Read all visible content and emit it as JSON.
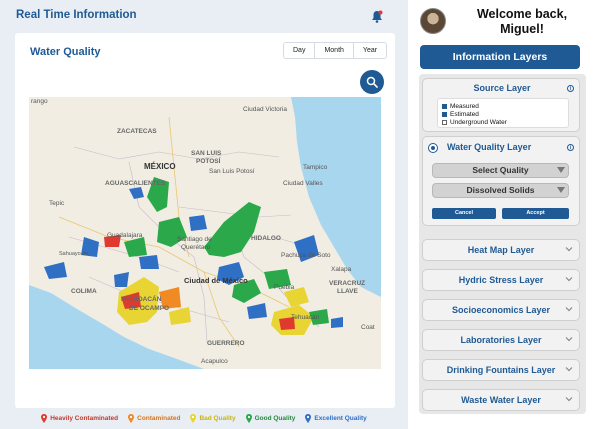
{
  "header": {
    "title": "Real Time Information"
  },
  "card": {
    "title": "Water Quality",
    "ranges": [
      "Day",
      "Month",
      "Year"
    ]
  },
  "map": {
    "labels": [
      "rango",
      "Ciudad Victoria",
      "ZACATECAS",
      "MÉXICO",
      "SAN LUIS",
      "POTOSÍ",
      "San Luis Potosí",
      "Tampico",
      "AGUASCALIENTES",
      "Ciudad Valles",
      "Tepic",
      "Guadalajara",
      "Santiago de",
      "Querétaro",
      "HIDALGO",
      "Pachuca de Soto",
      "Xalapa",
      "Sahuayo de",
      "Ciudad de México",
      "VERACRUZ",
      "LLAVE",
      "COLIMA",
      "MICHOACÁN",
      "DE OCAMPO",
      "Puebla",
      "Tehuacán",
      "Coat",
      "GUERRERO",
      "Acapulco"
    ]
  },
  "legend": [
    {
      "label": "Heavily Contaminated",
      "color": "#e03a2f"
    },
    {
      "label": "Contaminated",
      "color": "#f08a24"
    },
    {
      "label": "Bad Quality",
      "color": "#e8d534"
    },
    {
      "label": "Good Quality",
      "color": "#2aa84a"
    },
    {
      "label": "Excellent Quality",
      "color": "#2f6fc4"
    }
  ],
  "user": {
    "welcome_line1": "Welcome back,",
    "welcome_line2": "Miguel!"
  },
  "panel": {
    "title": "Information Layers",
    "source_layer": {
      "title": "Source Layer",
      "options": [
        {
          "label": "Measured",
          "checked": true
        },
        {
          "label": "Estimated",
          "checked": true
        },
        {
          "label": "Underground Water",
          "checked": false
        }
      ]
    },
    "water_quality_layer": {
      "title": "Water Quality Layer",
      "select_quality": "Select Quality",
      "selected": "Dissolved Solids",
      "cancel": "Cancel",
      "accept": "Accept"
    },
    "layers": [
      "Heat Map Layer",
      "Hydric Stress Layer",
      "Socioeconomics Layer",
      "Laboratories Layer",
      "Drinking Fountains Layer",
      "Waste Water Layer"
    ]
  },
  "colors": {
    "primary": "#1f5a94",
    "sea": "#a9d6ef"
  }
}
